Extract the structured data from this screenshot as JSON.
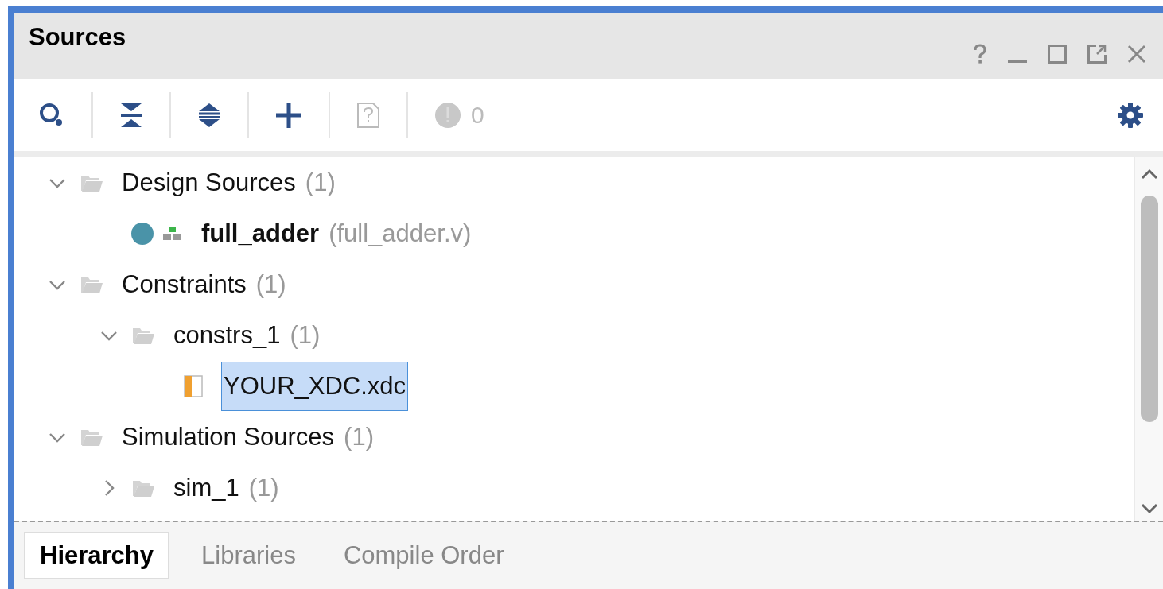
{
  "panel": {
    "title": "Sources"
  },
  "toolbar": {
    "warning_count": "0"
  },
  "tree": [
    {
      "kind": "folder",
      "label": "Design Sources",
      "count": "(1)",
      "expanded": true,
      "selected": false,
      "children": [
        {
          "kind": "module",
          "label": "full_adder",
          "file": "(full_adder.v)",
          "selected": false
        }
      ]
    },
    {
      "kind": "folder",
      "label": "Constraints",
      "count": "(1)",
      "expanded": true,
      "selected": false,
      "children": [
        {
          "kind": "folder",
          "label": "constrs_1",
          "count": "(1)",
          "expanded": true,
          "selected": false,
          "children": [
            {
              "kind": "xdc",
              "label": "YOUR_XDC.xdc",
              "selected": true
            }
          ]
        }
      ]
    },
    {
      "kind": "folder",
      "label": "Simulation Sources",
      "count": "(1)",
      "expanded": true,
      "selected": false,
      "children": [
        {
          "kind": "folder",
          "label": "sim_1",
          "count": "(1)",
          "expanded": false,
          "selected": false
        }
      ]
    }
  ],
  "tabs": [
    {
      "label": "Hierarchy",
      "selected": true
    },
    {
      "label": "Libraries",
      "selected": false
    },
    {
      "label": "Compile Order",
      "selected": false
    }
  ]
}
